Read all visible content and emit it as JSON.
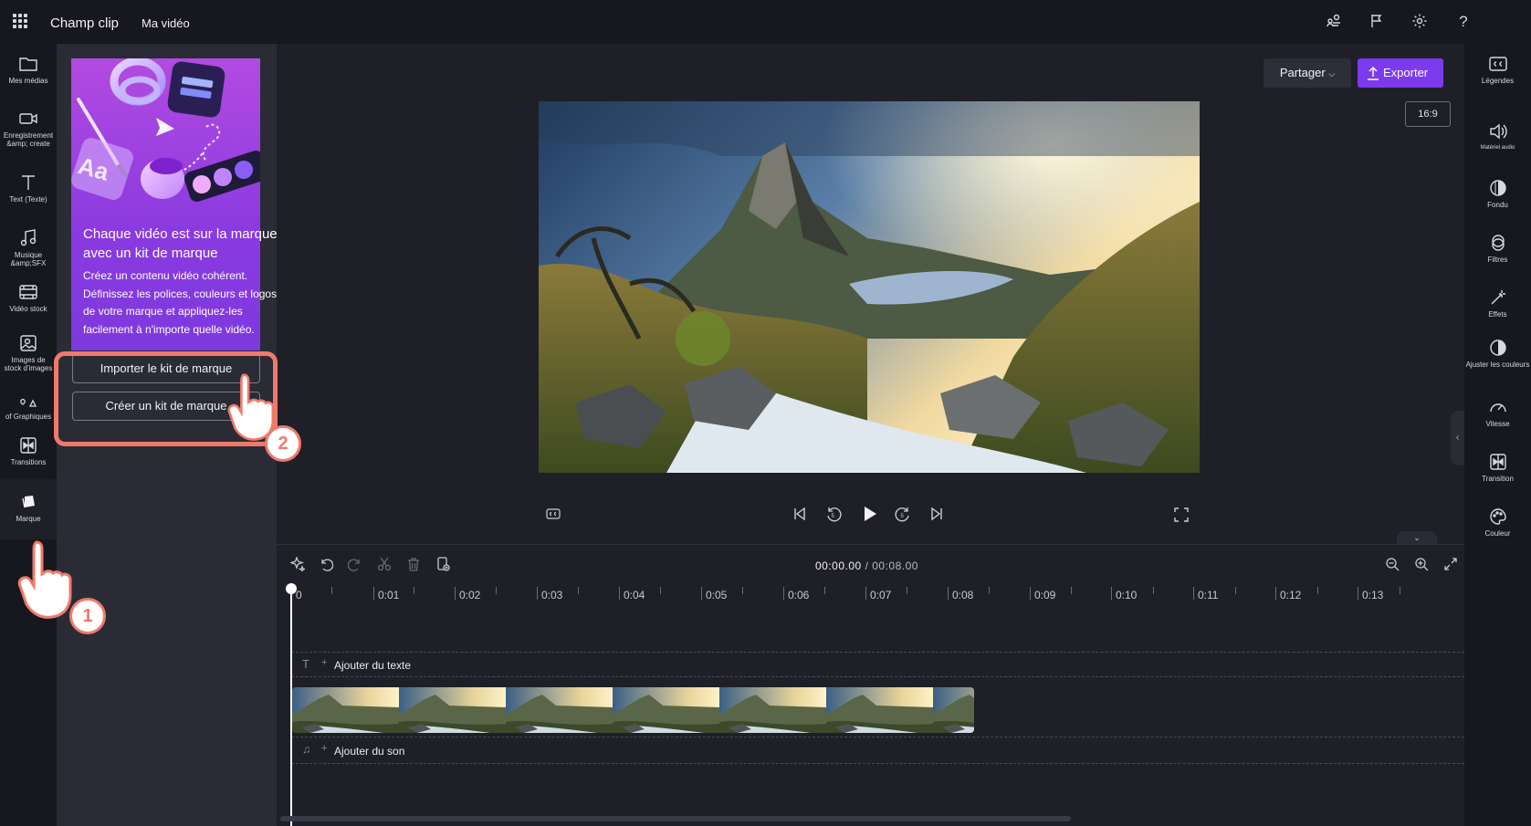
{
  "topbar": {
    "app_title": "Champ clip",
    "project_title": "Ma vidéo",
    "icons": [
      "people-icon",
      "flag-icon",
      "gear-icon",
      "help-icon"
    ],
    "help_glyph": "?"
  },
  "left_rail": {
    "items": [
      {
        "label": "Mes médias",
        "icon": "folder-icon"
      },
      {
        "label": "Enregistrement &amp; create",
        "icon": "camera-icon"
      },
      {
        "label": "Text (Texte)",
        "icon": "text-icon"
      },
      {
        "label": "Musique &amp;SFX",
        "icon": "music-icon"
      },
      {
        "label": "Vidéo stock",
        "icon": "film-icon"
      },
      {
        "label": "Images de stock d'images",
        "icon": "image-icon"
      },
      {
        "label": "of Graphiques",
        "icon": "shapes-icon"
      },
      {
        "label": "Transitions",
        "icon": "transition-icon"
      },
      {
        "label": "Marque",
        "icon": "brand-icon"
      }
    ]
  },
  "panel": {
    "promo_title": "Chaque vidéo est sur la marque avec un kit de marque",
    "promo_desc": "Créez un contenu vidéo cohérent. Définissez les polices, couleurs et logos de votre marque et appliquez-les facilement à n'importe quelle vidéo.",
    "promo_art_text": "Aa",
    "import_button": "Importer le kit de marque",
    "create_button": "Créer un kit de marque"
  },
  "preview": {
    "share_label": "Partager",
    "export_label": "Exporter",
    "ratio_label": "16:9"
  },
  "timeline": {
    "current_time": "00:00.00",
    "total_time": "/ 00:08.00",
    "ticks": [
      "0",
      "0:01",
      "0:02",
      "0:03",
      "0:04",
      "0:05",
      "0:06",
      "0:07",
      "0:08",
      "0:09",
      "0:10",
      "0:11",
      "0:12",
      "0:13"
    ],
    "text_track_label": "Ajouter du texte",
    "audio_track_label": "Ajouter du son"
  },
  "right_rail": {
    "items": [
      {
        "label": "Légendes",
        "icon": "captions-icon"
      },
      {
        "label": "Matériel audio",
        "icon": "speaker-icon"
      },
      {
        "label": "Fondu",
        "icon": "fade-icon"
      },
      {
        "label": "Filtres",
        "icon": "filters-icon"
      },
      {
        "label": "Effets",
        "icon": "magic-wand-icon"
      },
      {
        "label": "Ajuster les couleurs",
        "icon": "adjust-colors-icon"
      },
      {
        "label": "Vitesse",
        "icon": "speed-icon"
      },
      {
        "label": "Transition",
        "icon": "transition-icon"
      },
      {
        "label": "Couleur",
        "icon": "palette-icon"
      }
    ]
  },
  "annotations": {
    "step1": "1",
    "step2": "2"
  },
  "colors": {
    "accent": "#7c3aed",
    "highlight": "#f07a6a",
    "promo_gradient_top": "#b24be0",
    "promo_gradient_bottom": "#7d39dd"
  }
}
